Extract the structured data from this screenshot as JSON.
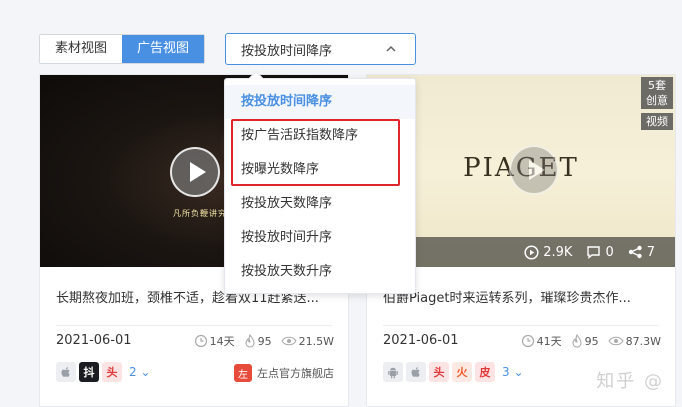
{
  "view_toggle": {
    "tabs": [
      {
        "label": "素材视图",
        "active": false
      },
      {
        "label": "广告视图",
        "active": true
      }
    ]
  },
  "sort_select": {
    "value": "按投放时间降序",
    "options": [
      "按投放时间降序",
      "按广告活跃指数降序",
      "按曝光数降序",
      "按投放天数降序",
      "按投放时间升序",
      "按投放天数升序"
    ],
    "selected_index": 0
  },
  "cards": [
    {
      "video_subtitle": "凡所负鞭讲究",
      "title": "长期熬夜加班，颈椎不适，趁着双11赶紧送...",
      "date": "2021-06-01",
      "days": "14天",
      "heat": "95",
      "views": "21.5W",
      "platforms": [
        "apple",
        "抖",
        "头"
      ],
      "more_count": "2",
      "store_name": "左点官方旗舰店",
      "store_logo": "左"
    },
    {
      "brand_text": "PIAGET",
      "badge_sets": "5套\n创意",
      "badge_video": "视频",
      "play_count": "2.9K",
      "comment_count": "0",
      "share_count": "7",
      "title": "伯爵Piaget时来运转系列，璀璨珍贵杰作...",
      "date": "2021-06-01",
      "days": "41天",
      "heat": "95",
      "views": "87.3W",
      "platforms": [
        "android",
        "apple",
        "头",
        "火",
        "皮"
      ],
      "more_count": "3"
    }
  ],
  "watermark": "知乎 @",
  "colors": {
    "accent": "#4a90e2",
    "highlight": "#e0262a"
  }
}
